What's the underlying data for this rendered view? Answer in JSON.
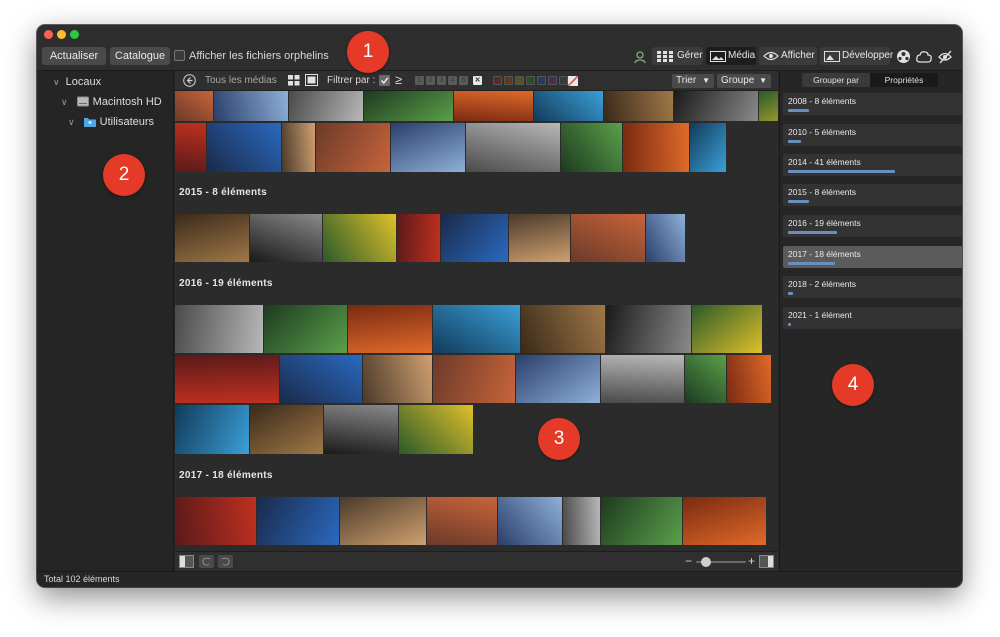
{
  "toolbar": {
    "refresh_label": "Actualiser",
    "catalog_label": "Catalogue",
    "orphans_label": "Afficher les fichiers orphelins",
    "manage_label": "Gérer",
    "media_label": "Média",
    "view_label": "Afficher",
    "develop_label": "Développer"
  },
  "sidebar": {
    "items": [
      {
        "label": "Locaux"
      },
      {
        "label": "Macintosh HD"
      },
      {
        "label": "Utilisateurs"
      }
    ]
  },
  "center": {
    "breadcrumb": "Tous les médias",
    "filter_label": "Filtrer par :",
    "ge_symbol": "≥",
    "ratings": [
      "1",
      "2",
      "3",
      "4",
      "5"
    ],
    "reject": "✕",
    "sort_label": "Trier",
    "group_label": "Groupe",
    "groups": [
      {
        "label": "2015 - 8 éléments"
      },
      {
        "label": "2016 - 19 éléments"
      },
      {
        "label": "2017 - 18 éléments"
      }
    ],
    "zoom_minus": "−",
    "zoom_plus": "+",
    "zoom_level": 0.2
  },
  "right_panel": {
    "tab_group_by": "Grouper par",
    "tab_properties": "Propriétés",
    "groups": [
      {
        "label": "2008 - 8 éléments",
        "count": 8
      },
      {
        "label": "2010 - 5 éléments",
        "count": 5
      },
      {
        "label": "2014 - 41 éléments",
        "count": 41
      },
      {
        "label": "2015 - 8 éléments",
        "count": 8
      },
      {
        "label": "2016 - 19 éléments",
        "count": 19
      },
      {
        "label": "2017 - 18 éléments",
        "count": 18
      },
      {
        "label": "2018 - 2 éléments",
        "count": 2
      },
      {
        "label": "2021 - 1 élément",
        "count": 1
      }
    ],
    "selected_index": 5
  },
  "status": {
    "total": "Total 102 éléments"
  },
  "markers": [
    "1",
    "2",
    "3",
    "4"
  ],
  "colors": {
    "accent_bar": "#6890bf",
    "marker": "#e43a27"
  }
}
